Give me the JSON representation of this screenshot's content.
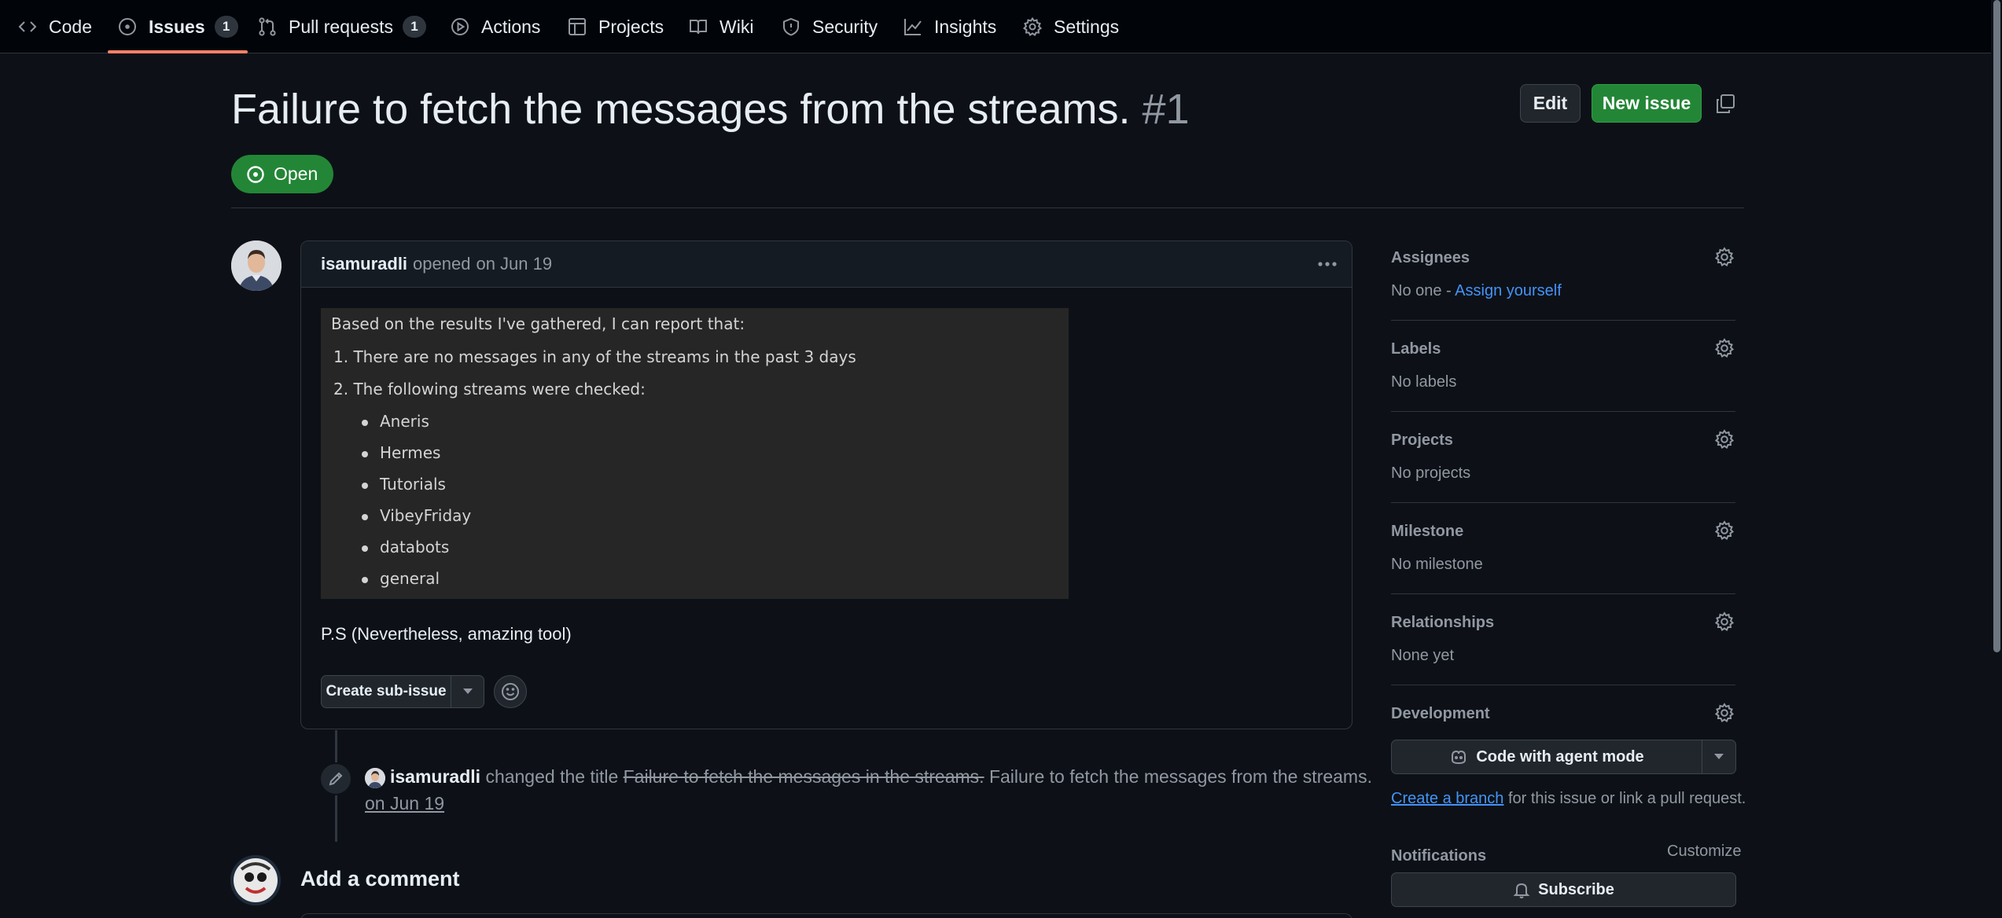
{
  "nav": {
    "code": "Code",
    "issues": "Issues",
    "issues_count": "1",
    "pulls": "Pull requests",
    "pulls_count": "1",
    "actions": "Actions",
    "projects": "Projects",
    "wiki": "Wiki",
    "security": "Security",
    "insights": "Insights",
    "settings": "Settings"
  },
  "issue": {
    "title": "Failure to fetch the messages from the streams.",
    "number": "#1",
    "state": "Open",
    "edit_label": "Edit",
    "new_issue_label": "New issue"
  },
  "comment": {
    "author": "isamuradli",
    "action": "opened",
    "date": "on Jun 19",
    "quote": {
      "intro": "Based on the results I've gathered, I can report that:",
      "point1": "1. There are no messages in any of the streams in the past 3 days",
      "point2": "2. The following streams were checked:",
      "streams": [
        "Aneris",
        "Hermes",
        "Tutorials",
        "VibeyFriday",
        "databots",
        "general"
      ]
    },
    "ps": "P.S (Nevertheless, amazing tool)",
    "create_sub_issue": "Create sub-issue"
  },
  "event": {
    "author": "isamuradli",
    "action": "changed the title",
    "old_title": "Failure to fetch the messages in the streams.",
    "new_title": "Failure to fetch the messages from the streams.",
    "date": "on Jun 19"
  },
  "add_comment": "Add a comment",
  "sidebar": {
    "assignees": {
      "heading": "Assignees",
      "value": "No one - ",
      "link": "Assign yourself"
    },
    "labels": {
      "heading": "Labels",
      "value": "No labels"
    },
    "projects": {
      "heading": "Projects",
      "value": "No projects"
    },
    "milestone": {
      "heading": "Milestone",
      "value": "No milestone"
    },
    "relationships": {
      "heading": "Relationships",
      "value": "None yet"
    },
    "development": {
      "heading": "Development",
      "agent_button": "Code with agent mode",
      "create_branch": "Create a branch",
      "rest": " for this issue or link a pull request."
    },
    "notifications": {
      "heading": "Notifications",
      "customize": "Customize",
      "subscribe": "Subscribe"
    }
  },
  "colors": {
    "background": "#0d1117",
    "accent_green": "#238636",
    "link_blue": "#4493f8",
    "tab_underline": "#f78166"
  }
}
